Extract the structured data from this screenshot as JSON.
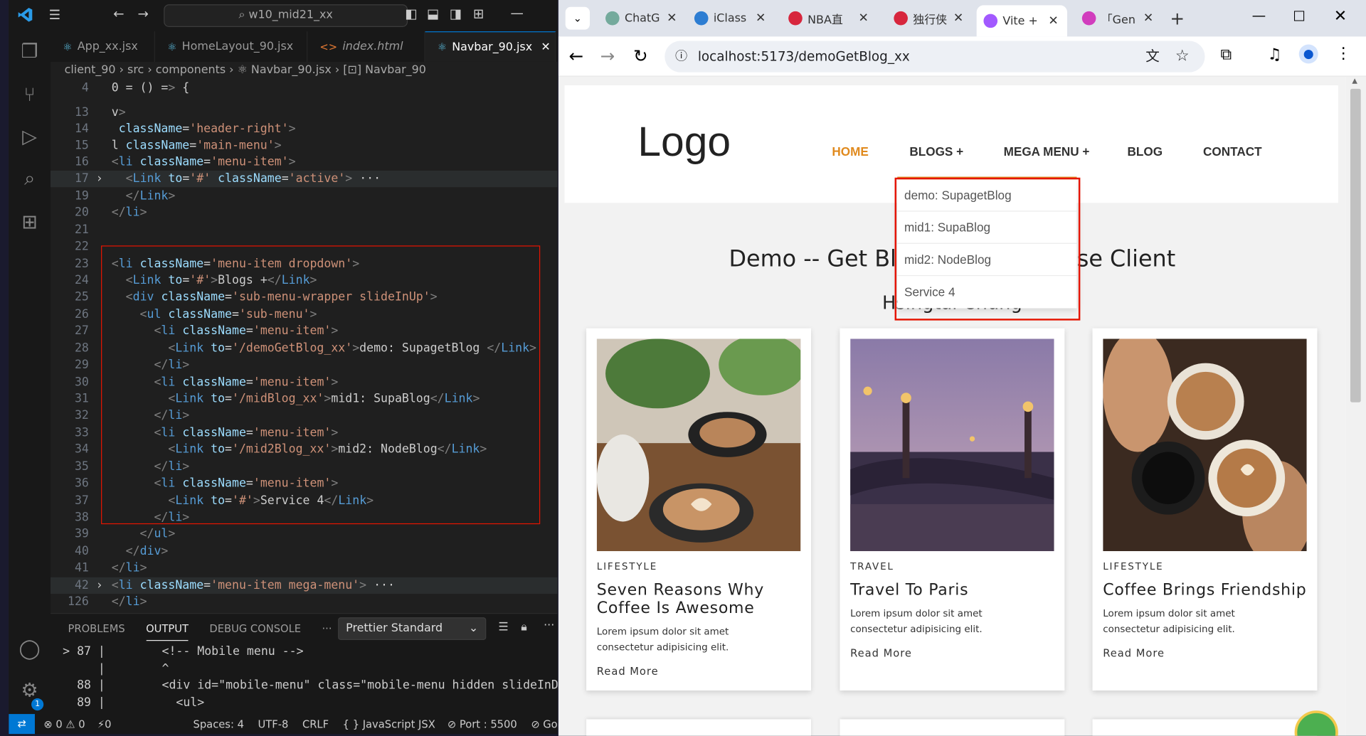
{
  "vscode": {
    "search_title": "w10_mid21_xx",
    "tabs": [
      {
        "label": "App_xx.jsx",
        "icon": "⚛"
      },
      {
        "label": "HomeLayout_90.jsx",
        "icon": "⚛"
      },
      {
        "label": "index.html",
        "icon": "<>"
      },
      {
        "label": "Navbar_90.jsx",
        "icon": "⚛",
        "close": "✕"
      }
    ],
    "breadcrumb": "client_90 › src › components › ⚛ Navbar_90.jsx › [⊡] Navbar_90",
    "code_lines": [
      {
        "n": "4",
        "t": "0 = () => {"
      },
      {
        "n": "13",
        "t": "v>"
      },
      {
        "n": "14",
        "t": " className='header-right'>"
      },
      {
        "n": "15",
        "t": "l className='main-menu'>"
      },
      {
        "n": "16",
        "t": "<li className='menu-item'>"
      },
      {
        "n": "17",
        "t": "  <Link to='#' className='active'> ···"
      },
      {
        "n": "19",
        "t": "  </Link>"
      },
      {
        "n": "20",
        "t": "</li>"
      },
      {
        "n": "21",
        "t": ""
      },
      {
        "n": "22",
        "t": ""
      },
      {
        "n": "23",
        "t": "<li className='menu-item dropdown'>"
      },
      {
        "n": "24",
        "t": "  <Link to='#'>Blogs +</Link>"
      },
      {
        "n": "25",
        "t": "  <div className='sub-menu-wrapper slideInUp'>"
      },
      {
        "n": "26",
        "t": "    <ul className='sub-menu'>"
      },
      {
        "n": "27",
        "t": "      <li className='menu-item'>"
      },
      {
        "n": "28",
        "t": "        <Link to='/demoGetBlog_xx'>demo: SupagetBlog </Link>"
      },
      {
        "n": "29",
        "t": "      </li>"
      },
      {
        "n": "30",
        "t": "      <li className='menu-item'>"
      },
      {
        "n": "31",
        "t": "        <Link to='/midBlog_xx'>mid1: SupaBlog</Link>"
      },
      {
        "n": "32",
        "t": "      </li>"
      },
      {
        "n": "33",
        "t": "      <li className='menu-item'>"
      },
      {
        "n": "34",
        "t": "        <Link to='/mid2Blog_xx'>mid2: NodeBlog</Link>"
      },
      {
        "n": "35",
        "t": "      </li>"
      },
      {
        "n": "36",
        "t": "      <li className='menu-item'>"
      },
      {
        "n": "37",
        "t": "        <Link to='#'>Service 4</Link>"
      },
      {
        "n": "38",
        "t": "      </li>"
      },
      {
        "n": "39",
        "t": "    </ul>"
      },
      {
        "n": "40",
        "t": "  </div>"
      },
      {
        "n": "41",
        "t": "</li>"
      },
      {
        "n": "42",
        "t": "<li className='menu-item mega-menu'> ···"
      },
      {
        "n": "126",
        "t": "</li>"
      }
    ],
    "panel_tabs": [
      "PROBLEMS",
      "OUTPUT",
      "DEBUG CONSOLE",
      "···"
    ],
    "formatter": "Prettier Standard",
    "output_lines": [
      "> 87 |        <!-- Mobile menu -->",
      "     |        ^",
      "  88 |        <div id=\"mobile-menu\" class=\"mobile-menu hidden slideInDo",
      "  89 |          <ul>"
    ],
    "status": {
      "errors": "⊗ 0 ⚠ 0",
      "ports": "⚡0",
      "spaces": "Spaces: 4",
      "encoding": "UTF-8",
      "eol": "CRLF",
      "language": "{ } JavaScript JSX",
      "port": "⊘ Port : 5500",
      "golive": "⊘ Go"
    },
    "badge": "1"
  },
  "chrome": {
    "tabs": [
      {
        "label": "ChatG",
        "color": "#74aa9c"
      },
      {
        "label": "iClass",
        "color": "#2d7dd2"
      },
      {
        "label": "NBA直",
        "color": "#d7263d"
      },
      {
        "label": "独行侠",
        "color": "#d7263d"
      },
      {
        "label": "Vite +",
        "color": "#a259ff"
      },
      {
        "label": "「Gen",
        "color": "#d13dbd"
      }
    ],
    "url": "localhost:5173/demoGetBlog_xx",
    "site": {
      "logo": "Logo",
      "nav": [
        "HOME",
        "BLOGS +",
        "MEGA MENU +",
        "BLOG",
        "CONTACT"
      ],
      "dropdown": [
        "demo: SupagetBlog",
        "mid1: SupaBlog",
        "mid2: NodeBlog",
        "Service 4"
      ],
      "heading": "Demo -- Get Blog from Supabase Client",
      "subheading": "Hsingtai Chung",
      "cards": [
        {
          "category": "LIFESTYLE",
          "title": "Seven Reasons Why Coffee Is Awesome",
          "excerpt": "Lorem ipsum dolor sit amet consectetur adipisicing elit.",
          "more": "Read More"
        },
        {
          "category": "TRAVEL",
          "title": "Travel To Paris",
          "excerpt": "Lorem ipsum dolor sit amet consectetur adipisicing elit.",
          "more": "Read More"
        },
        {
          "category": "LIFESTYLE",
          "title": "Coffee Brings Friendship",
          "excerpt": "Lorem ipsum dolor sit amet consectetur adipisicing elit.",
          "more": "Read More"
        }
      ]
    }
  }
}
